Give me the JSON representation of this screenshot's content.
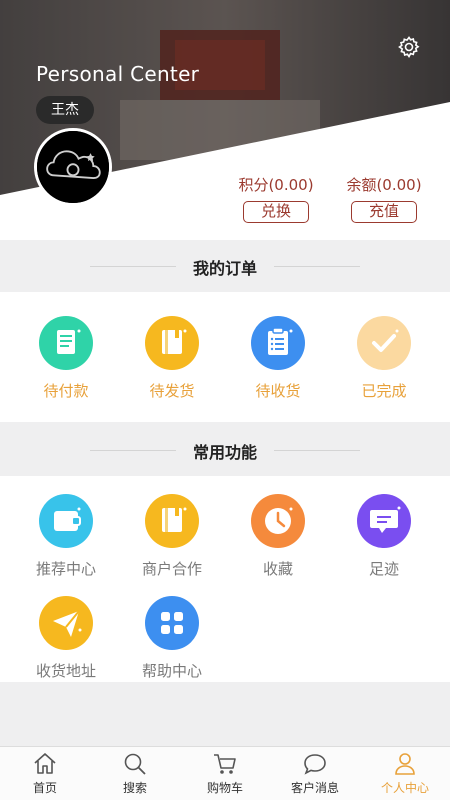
{
  "header": {
    "title": "Personal Center",
    "user_name": "王杰",
    "points_label": "积分(0.00)",
    "points_action": "兑换",
    "balance_label": "余额(0.00)",
    "balance_action": "充值",
    "settings_icon": "gear-icon"
  },
  "orders": {
    "title": "我的订单",
    "items": [
      {
        "label": "待付款",
        "icon": "document-icon",
        "color": "#2fd3a8"
      },
      {
        "label": "待发货",
        "icon": "book-icon",
        "color": "#f6b81f"
      },
      {
        "label": "待收货",
        "icon": "clipboard-icon",
        "color": "#3d8ff0"
      },
      {
        "label": "已完成",
        "icon": "checkmark-icon",
        "color": "#fbd9a0"
      }
    ]
  },
  "tools": {
    "title": "常用功能",
    "items": [
      {
        "label": "推荐中心",
        "icon": "wallet-icon",
        "color": "#38c3ea"
      },
      {
        "label": "商户合作",
        "icon": "notebook-icon",
        "color": "#f6b81f"
      },
      {
        "label": "收藏",
        "icon": "clock-icon",
        "color": "#f58a3c"
      },
      {
        "label": "足迹",
        "icon": "message-icon",
        "color": "#7a4ef0"
      },
      {
        "label": "收货地址",
        "icon": "paper-plane-icon",
        "color": "#f6b81f"
      },
      {
        "label": "帮助中心",
        "icon": "grid-icon",
        "color": "#3d8ff0"
      }
    ]
  },
  "tabbar": {
    "items": [
      {
        "label": "首页",
        "icon": "home-icon"
      },
      {
        "label": "搜索",
        "icon": "search-icon"
      },
      {
        "label": "购物车",
        "icon": "cart-icon"
      },
      {
        "label": "客户消息",
        "icon": "chat-icon"
      },
      {
        "label": "个人中心",
        "icon": "person-icon"
      }
    ],
    "active_index": 4,
    "active_color": "#e8a13a"
  }
}
